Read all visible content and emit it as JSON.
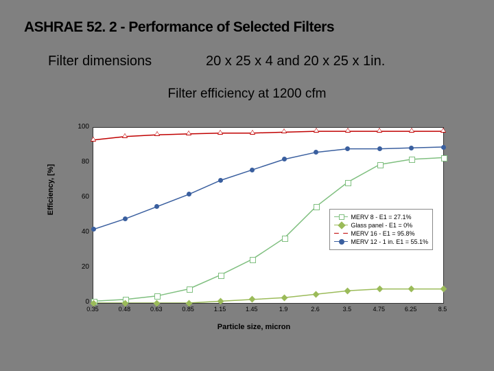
{
  "title": "ASHRAE 52. 2 - Performance of Selected Filters",
  "filter_dims_label": "Filter dimensions",
  "filter_dims_value": "20 x 25 x 4  and 20 x 25 x 1in.",
  "chart_title": "Filter efficiency at 1200 cfm",
  "ylabel": "Efficiency, [%]",
  "xlabel": "Particle size, micron",
  "chart_data": {
    "type": "line",
    "xlabel": "Particle size, micron",
    "ylabel": "Efficiency, [%]",
    "ylim": [
      0,
      100
    ],
    "categories": [
      "0.35",
      "0.48",
      "0.63",
      "0.85",
      "1.15",
      "1.45",
      "1.9",
      "2.6",
      "3.5",
      "4.75",
      "6.25",
      "8.5"
    ],
    "series": [
      {
        "name": "MERV 8 - E1 = 27.1%",
        "color": "#7fbf7f",
        "marker": "sq",
        "values": [
          1,
          2,
          4,
          8,
          16,
          25,
          37,
          55,
          69,
          79,
          82,
          83
        ]
      },
      {
        "name": "Glass panel - E1 = 0%",
        "color": "#9bbb59",
        "marker": "di",
        "values": [
          0,
          0,
          0,
          0,
          1,
          2,
          3,
          5,
          7,
          8,
          8,
          8
        ]
      },
      {
        "name": "MERV 16 - E1 = 95.8%",
        "color": "#c00000",
        "marker": "tr",
        "values": [
          93,
          95,
          96,
          96.5,
          97,
          97,
          97.5,
          98,
          98,
          98,
          98,
          98
        ]
      },
      {
        "name": "MERV 12 - 1 in. E1 = 55.1%",
        "color": "#3a5f9f",
        "marker": "ci",
        "values": [
          42,
          48,
          55,
          62,
          70,
          76,
          82,
          86,
          88,
          88,
          88.5,
          89
        ]
      }
    ],
    "legend": {
      "position": "right"
    }
  },
  "yticks": [
    "0",
    "20",
    "40",
    "60",
    "80",
    "100"
  ]
}
